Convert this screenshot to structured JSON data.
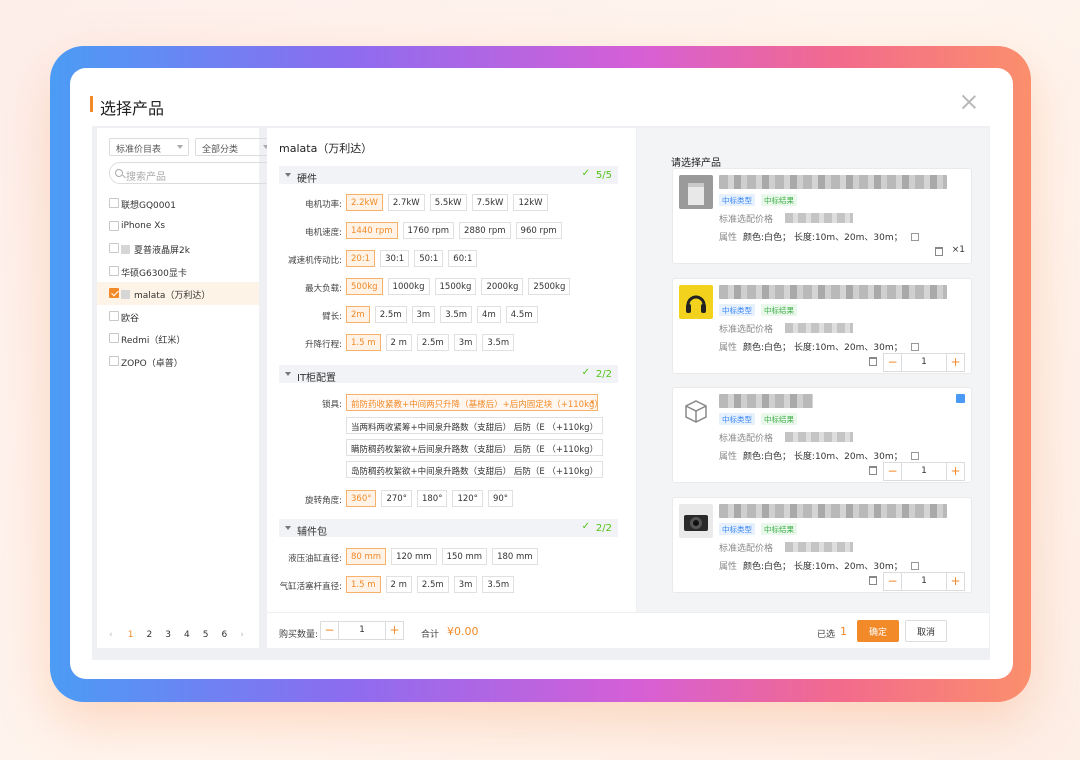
{
  "dialog": {
    "title": "选择产品"
  },
  "left": {
    "price_list_select": "标准价目表",
    "category_select": "全部分类",
    "search_placeholder": "搜索产品",
    "products": [
      {
        "label": "联想GQ0001",
        "checked": false,
        "thumb": false
      },
      {
        "label": "iPhone Xs",
        "checked": false,
        "thumb": false
      },
      {
        "label": "夏普液晶屏2k",
        "checked": false,
        "thumb": true
      },
      {
        "label": "华硕G6300显卡",
        "checked": false,
        "thumb": false
      },
      {
        "label": "malata（万利达）",
        "checked": true,
        "thumb": true
      },
      {
        "label": "欧谷",
        "checked": false,
        "thumb": false
      },
      {
        "label": "Redmi（红米）",
        "checked": false,
        "thumb": false
      },
      {
        "label": "ZOPO（卓普）",
        "checked": false,
        "thumb": false
      }
    ],
    "pager": {
      "prev": "‹",
      "pages": [
        "1",
        "2",
        "3",
        "4",
        "5",
        "6"
      ],
      "current": "1",
      "next": "›"
    }
  },
  "middle": {
    "product_name": "malata（万利达）",
    "sections": [
      {
        "title": "硬件",
        "progress": "5/5"
      },
      {
        "title": "IT柜配置",
        "progress": "2/2"
      },
      {
        "title": "辅件包",
        "progress": "2/2"
      }
    ],
    "hardware": [
      {
        "label": "电机功率:",
        "options": [
          "2.2kW",
          "2.7kW",
          "5.5kW",
          "7.5kW",
          "12kW"
        ],
        "selected": 0
      },
      {
        "label": "电机速度:",
        "options": [
          "1440 rpm",
          "1760 rpm",
          "2880 rpm",
          "960 rpm"
        ],
        "selected": 0
      },
      {
        "label": "减速机传动比:",
        "options": [
          "20:1",
          "30:1",
          "50:1",
          "60:1"
        ],
        "selected": 0
      },
      {
        "label": "最大负载:",
        "options": [
          "500kg",
          "1000kg",
          "1500kg",
          "2000kg",
          "2500kg"
        ],
        "selected": 0
      },
      {
        "label": "臂长:",
        "options": [
          "2m",
          "2.5m",
          "3m",
          "3.5m",
          "4m",
          "4.5m"
        ],
        "selected": 0
      },
      {
        "label": "升降行程:",
        "options": [
          "1.5 m",
          "2 m",
          "2.5m",
          "3m",
          "3.5m"
        ],
        "selected": 0
      }
    ],
    "it": {
      "tool_label": "锁具:",
      "tool_options": [
        "前防药收紧教+中间两只升降（基楼后）+后内固定块（+110kg）",
        "当两料两收紧筹+中间泉升路数（支甜后） 后防（E （+110kg）",
        "瞒防稠药枚絮欲+后间泉升路数（支甜后） 后防（E （+110kg）",
        "岛防稠药枚絮欲+中间泉升路数（支甜后） 后防（E （+110kg）"
      ],
      "rotation_label": "旋转角度:",
      "rotation_options": [
        "360°",
        "270°",
        "180°",
        "120°",
        "90°"
      ],
      "rotation_selected": 0
    },
    "accessories": [
      {
        "label": "液压油缸直径:",
        "options": [
          "80 mm",
          "120 mm",
          "150 mm",
          "180 mm"
        ],
        "selected": 0
      },
      {
        "label": "气缸活塞杆直径:",
        "options": [
          "1.5 m",
          "2 m",
          "2.5m",
          "3m",
          "3.5m"
        ],
        "selected": 0
      }
    ]
  },
  "footer": {
    "qty_label": "购买数量:",
    "qty_value": "1",
    "minus": "−",
    "plus": "+",
    "total_label": "合计",
    "total_value": "¥0.00",
    "selected_label": "已选",
    "selected_count": "1",
    "confirm": "确定",
    "cancel": "取消"
  },
  "right": {
    "title": "请选择产品",
    "cards": [
      {
        "tag1": "中标类型",
        "tag2": "中标结果",
        "price_label": "标准选配价格",
        "attr_key": "属性",
        "attr_value": "颜色:白色；  长度:10m、20m、30m；",
        "qty_text": "×1",
        "icon": "bag-photo"
      },
      {
        "tag1": "中标类型",
        "tag2": "中标结果",
        "price_label": "标准选配价格",
        "attr_key": "属性",
        "attr_value": "颜色:白色；  长度:10m、20m、30m；",
        "qty_value": "1",
        "icon": "headphones-photo"
      },
      {
        "tag1": "中标类型",
        "tag2": "中标结果",
        "price_label": "标准选配价格",
        "attr_key": "属性",
        "attr_value": "颜色:白色；  长度:10m、20m、30m；",
        "qty_value": "1",
        "icon": "box-icon"
      },
      {
        "tag1": "中标类型",
        "tag2": "中标结果",
        "price_label": "标准选配价格",
        "attr_key": "属性",
        "attr_value": "颜色:白色；  长度:10m、20m、30m；",
        "qty_value": "1",
        "icon": "camera-photo"
      }
    ]
  },
  "colors": {
    "accent": "#f28a2a",
    "success": "#52c41a",
    "tag_blue": "#3a86f2",
    "tag_green": "#3fb04a"
  }
}
